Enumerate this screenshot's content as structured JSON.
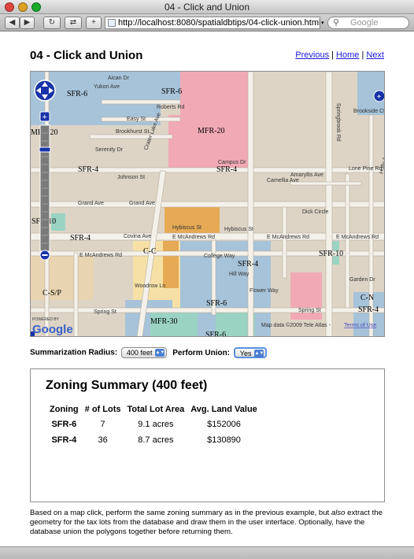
{
  "window": {
    "title": "04 - Click and Union"
  },
  "toolbar": {
    "url": "http://localhost:8080/spatialdbtips/04-click-union.html",
    "search_placeholder": "Google"
  },
  "page": {
    "heading": "04 - Click and Union",
    "nav": {
      "previous": "Previous",
      "separator": "|",
      "home": "Home",
      "next": "Next"
    }
  },
  "map": {
    "zones": [
      "SFR-6",
      "SFR-6",
      "MFR-20",
      "SFR-4",
      "SFR-4",
      "MFR-20",
      "SFR-10",
      "SFR-4",
      "C-C",
      "SFR-4",
      "SFR-10",
      "C-S/P",
      "SFR-6",
      "SFR-4",
      "MFR-30",
      "C-N",
      "SFR-6"
    ],
    "streets": [
      "Yukon Ave",
      "Aican Dr",
      "Roberts Rd",
      "Easy St",
      "Brookhurst St",
      "Serenity Dr",
      "Johnson St",
      "Grand Ave",
      "Grand Ave",
      "Hybiscus St",
      "Hybiscus St",
      "Covina Ave",
      "E McAndrews Rd",
      "E McAndrews Rd",
      "E McAndrews Rd",
      "E McAndrews Rd",
      "College Way",
      "Hill Way",
      "Flower Way",
      "Woodrow Ln",
      "Spring St",
      "Spring St",
      "Campus Dr",
      "Camellia Ave",
      "Amaryllis Ave",
      "Lone Pine Rd",
      "Garden Dr",
      "Brookside Ct",
      "Dick Circle",
      "Crater Lake Ave",
      "Springbrook Rd",
      "Holly Ave"
    ],
    "powered_by": "POWERED BY",
    "google_logo": "Google",
    "copyright": "Map data ©2009 Tele Atlas -",
    "terms": "Terms of Use"
  },
  "controls": {
    "radius_label": "Summarization Radius:",
    "radius_value": "400 feet",
    "union_label": "Perform Union:",
    "union_value": "Yes"
  },
  "summary": {
    "title": "Zoning Summary (400 feet)",
    "columns": [
      "Zoning",
      "# of Lots",
      "Total Lot Area",
      "Avg. Land Value"
    ],
    "rows": [
      [
        "SFR-6",
        "7",
        "9.1 acres",
        "$152006"
      ],
      [
        "SFR-4",
        "36",
        "8.7 acres",
        "$130890"
      ]
    ]
  },
  "description": {
    "before": "Based on a map click, perform the same zoning summary as in the previous example, but ",
    "emph": "also",
    "after": " extract the geometry for the tax lots from the database and draw them in the user interface. Optionally, have the database union the polygons together before returning them."
  }
}
